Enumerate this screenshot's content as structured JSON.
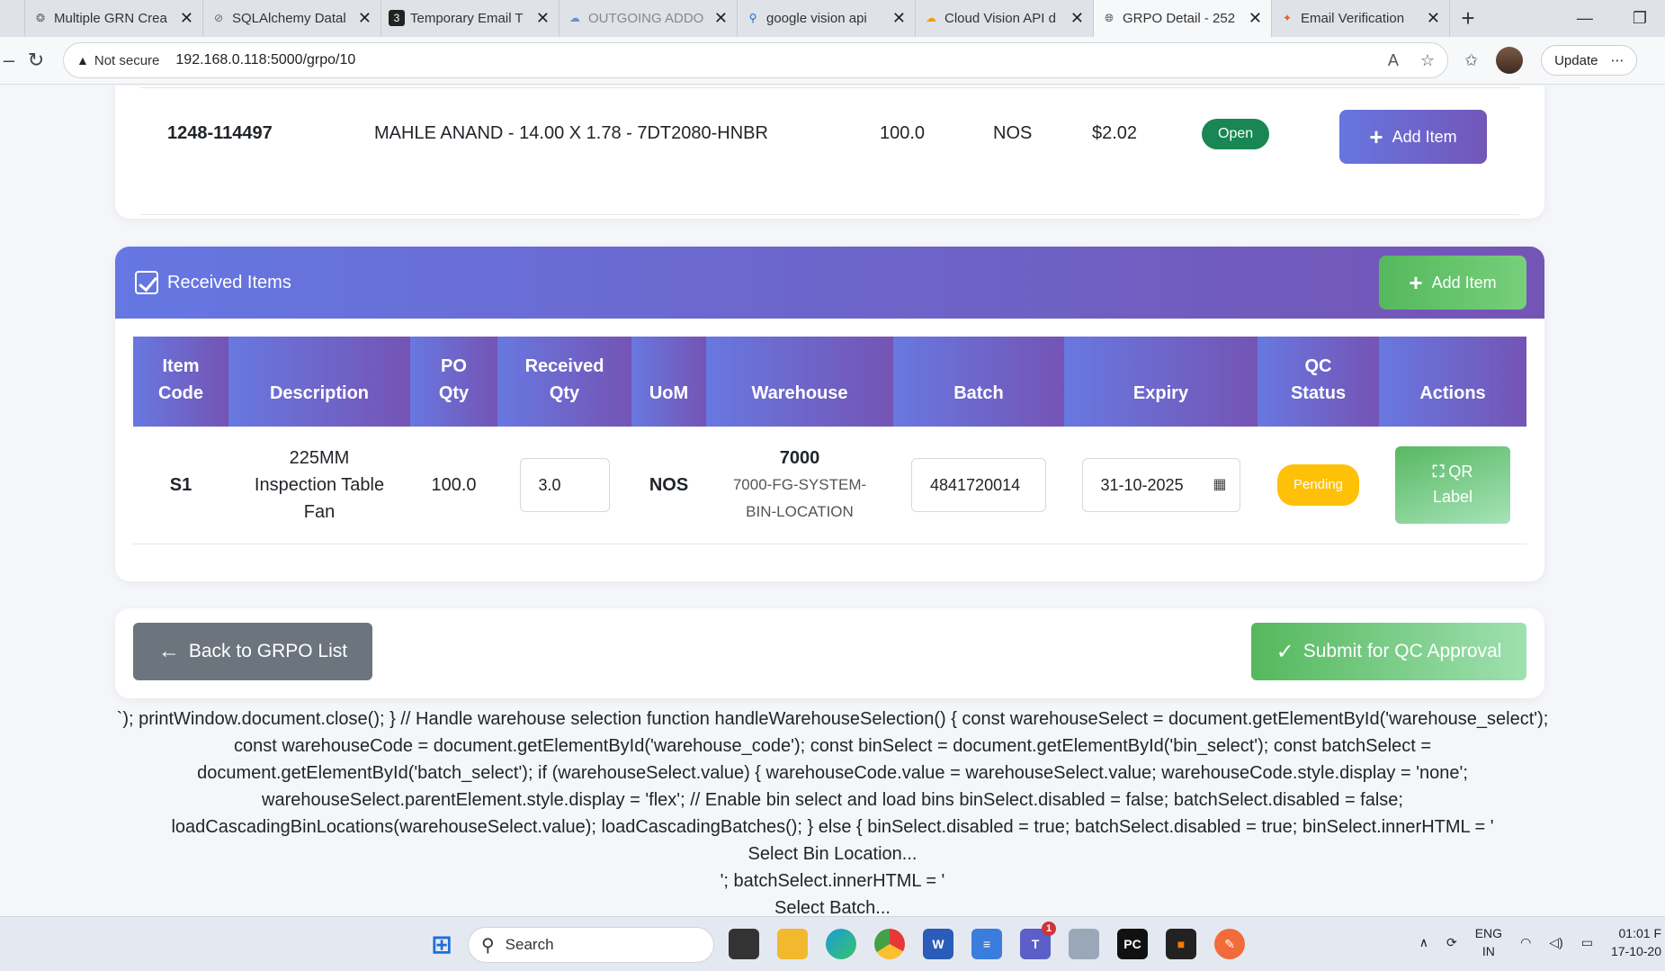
{
  "browser": {
    "tabs": [
      {
        "title": "Multiple GRN Crea",
        "active": false
      },
      {
        "title": "SQLAlchemy Datal",
        "active": false
      },
      {
        "title": "Temporary Email T",
        "active": false
      },
      {
        "title": "OUTGOING ADDO",
        "active": false
      },
      {
        "title": "google vision api",
        "active": false
      },
      {
        "title": "Cloud Vision API d",
        "active": false
      },
      {
        "title": "GRPO Detail - 252",
        "active": true
      },
      {
        "title": "Email Verification",
        "active": false
      }
    ],
    "not_secure": "Not secure",
    "url": "192.168.0.118:5000/grpo/10",
    "update_label": "Update"
  },
  "po_item": {
    "code": "1248-114497",
    "description": "MAHLE ANAND - 14.00 X 1.78 - 7DT2080-HNBR",
    "qty": "100.0",
    "uom": "NOS",
    "price": "$2.02",
    "status": "Open",
    "add_item_label": "Add Item"
  },
  "received": {
    "title": "Received Items",
    "add_item_label": "Add Item",
    "columns": [
      {
        "line1": "Item",
        "line2": "Code"
      },
      {
        "line1": "",
        "line2": "Description"
      },
      {
        "line1": "PO",
        "line2": "Qty"
      },
      {
        "line1": "Received",
        "line2": "Qty"
      },
      {
        "line1": "",
        "line2": "UoM"
      },
      {
        "line1": "",
        "line2": "Warehouse"
      },
      {
        "line1": "",
        "line2": "Batch"
      },
      {
        "line1": "",
        "line2": "Expiry"
      },
      {
        "line1": "QC",
        "line2": "Status"
      },
      {
        "line1": "",
        "line2": "Actions"
      }
    ],
    "row": {
      "item_code": "S1",
      "description_l1": "225MM",
      "description_l2": "Inspection Table",
      "description_l3": "Fan",
      "po_qty": "100.0",
      "received_qty": "3.0",
      "uom": "NOS",
      "warehouse_code": "7000",
      "warehouse_bin_l1": "7000-FG-SYSTEM-",
      "warehouse_bin_l2": "BIN-LOCATION",
      "batch": "4841720014",
      "expiry": "31-10-2025",
      "qc_status": "Pending",
      "qr_label_l1": "QR",
      "qr_label_l2": "Label"
    }
  },
  "footer_actions": {
    "back_label": "Back to GRPO List",
    "submit_label": "Submit for QC Approval"
  },
  "leaked_script_lines": [
    "`); printWindow.document.close(); } // Handle warehouse selection function handleWarehouseSelection() { const warehouseSelect = document.getElementById('warehouse_select');",
    "const warehouseCode = document.getElementById('warehouse_code'); const binSelect = document.getElementById('bin_select'); const batchSelect =",
    "document.getElementById('batch_select'); if (warehouseSelect.value) { warehouseCode.value = warehouseSelect.value; warehouseCode.style.display = 'none';",
    "warehouseSelect.parentElement.style.display = 'flex'; // Enable bin select and load bins binSelect.disabled = false; batchSelect.disabled = false;",
    "loadCascadingBinLocations(warehouseSelect.value); loadCascadingBatches(); } else { binSelect.disabled = true; batchSelect.disabled = true; binSelect.innerHTML = '",
    "Select Bin Location...",
    "'; batchSelect.innerHTML = '",
    "Select Batch..."
  ],
  "taskbar": {
    "search_placeholder": "Search",
    "lang_l1": "ENG",
    "lang_l2": "IN",
    "time": "01:01 F",
    "date": "17-10-20",
    "teams_badge": "1"
  },
  "colors": {
    "header_gradient_start": "#6577e2",
    "header_gradient_end": "#7454b4",
    "success": "#198754",
    "green_button": "#55b85d",
    "warning": "#ffc107",
    "secondary": "#6c757d"
  }
}
